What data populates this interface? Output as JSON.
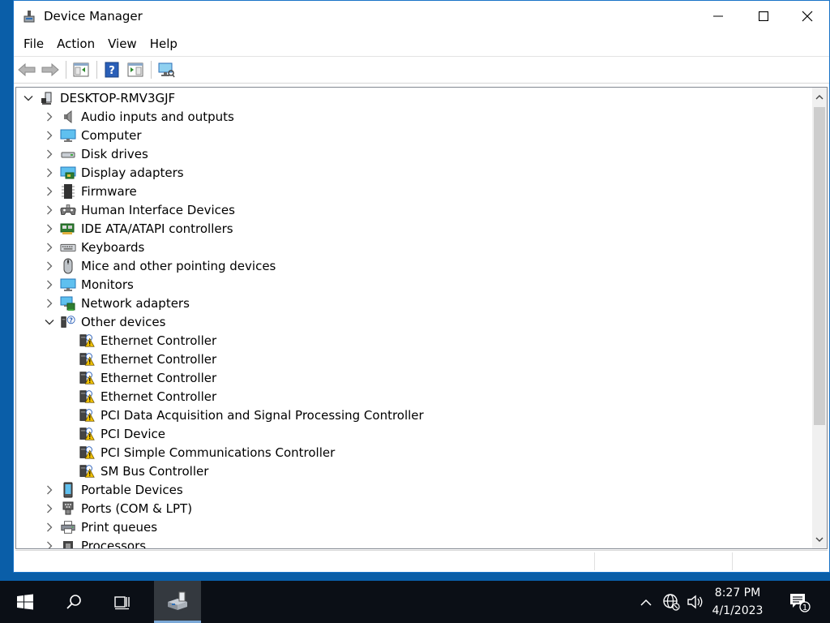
{
  "window": {
    "title": "Device Manager",
    "icons": {
      "app": "device-manager-icon",
      "minimize": "minimize-icon",
      "maximize": "maximize-icon",
      "close": "close-icon"
    }
  },
  "menu": [
    "File",
    "Action",
    "View",
    "Help"
  ],
  "toolbar": {
    "icons": [
      "back-arrow-icon",
      "forward-arrow-icon",
      "properties-pane-icon",
      "help-icon",
      "update-driver-icon",
      "scan-hardware-icon"
    ]
  },
  "tree": {
    "root": {
      "label": "DESKTOP-RMV3GJF",
      "expanded": true,
      "icon": "computer-tower-icon"
    },
    "categories": [
      {
        "label": "Audio inputs and outputs",
        "icon": "speaker-icon"
      },
      {
        "label": "Computer",
        "icon": "monitor-icon"
      },
      {
        "label": "Disk drives",
        "icon": "disk-drive-icon"
      },
      {
        "label": "Display adapters",
        "icon": "display-adapter-icon"
      },
      {
        "label": "Firmware",
        "icon": "chip-icon"
      },
      {
        "label": "Human Interface Devices",
        "icon": "gamepad-icon"
      },
      {
        "label": "IDE ATA/ATAPI controllers",
        "icon": "controller-card-icon"
      },
      {
        "label": "Keyboards",
        "icon": "keyboard-icon"
      },
      {
        "label": "Mice and other pointing devices",
        "icon": "mouse-icon"
      },
      {
        "label": "Monitors",
        "icon": "monitor-icon"
      },
      {
        "label": "Network adapters",
        "icon": "network-adapter-icon"
      },
      {
        "label": "Other devices",
        "icon": "unknown-device-icon",
        "expanded": true,
        "children": [
          "Ethernet Controller",
          "Ethernet Controller",
          "Ethernet Controller",
          "Ethernet Controller",
          "PCI Data Acquisition and Signal Processing Controller",
          "PCI Device",
          "PCI Simple Communications Controller",
          "SM Bus Controller"
        ]
      },
      {
        "label": "Portable Devices",
        "icon": "portable-device-icon"
      },
      {
        "label": "Ports (COM & LPT)",
        "icon": "port-icon"
      },
      {
        "label": "Print queues",
        "icon": "printer-icon"
      },
      {
        "label": "Processors",
        "icon": "processor-icon"
      }
    ]
  },
  "taskbar": {
    "time": "8:27 PM",
    "date": "4/1/2023",
    "icons": [
      "windows-start-icon",
      "search-icon",
      "task-view-icon",
      "device-manager-icon",
      "chevron-up-icon",
      "globe-network-icon",
      "volume-icon",
      "notifications-icon"
    ],
    "notification_count": "1"
  },
  "colors": {
    "accent": "#0a5ea8",
    "taskbar": "#0b0f16",
    "warning": "#f2c200"
  }
}
